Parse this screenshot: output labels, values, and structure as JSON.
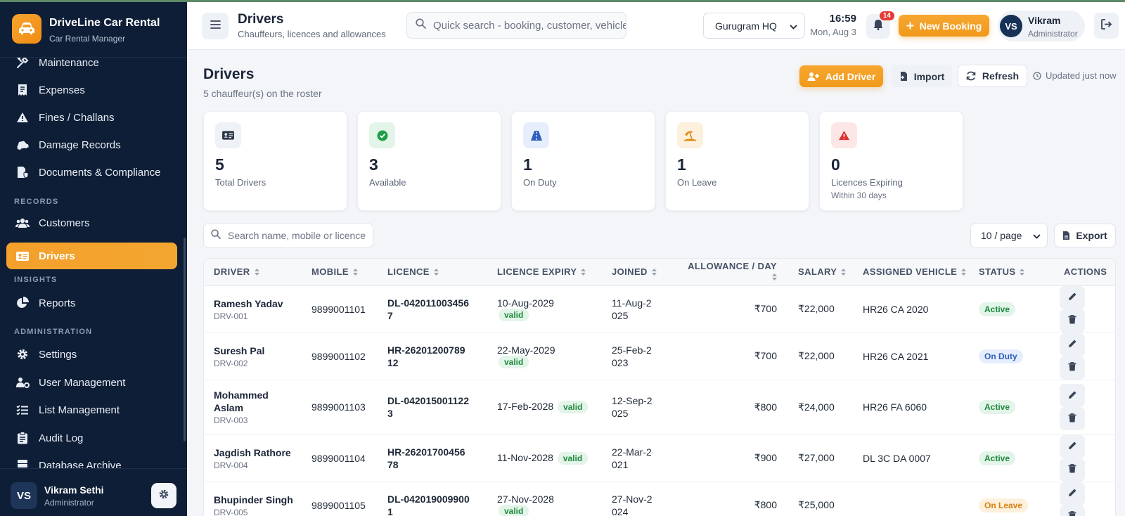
{
  "brand": {
    "name": "DriveLine Car Rental",
    "subtitle": "Car Rental Manager"
  },
  "sidebar": {
    "items": [
      {
        "label": "Maintenance",
        "icon": "tools-icon"
      },
      {
        "label": "Expenses",
        "icon": "receipt-icon"
      },
      {
        "label": "Fines / Challans",
        "icon": "warning-icon"
      },
      {
        "label": "Damage Records",
        "icon": "car-crash-icon"
      },
      {
        "label": "Documents & Compliance",
        "icon": "file-shield-icon"
      }
    ],
    "section_records": "RECORDS",
    "records_items": [
      {
        "label": "Customers",
        "icon": "users-icon"
      },
      {
        "label": "Drivers",
        "icon": "id-card-icon",
        "active": true
      }
    ],
    "section_insights": "INSIGHTS",
    "insights_items": [
      {
        "label": "Reports",
        "icon": "pie-chart-icon"
      }
    ],
    "section_admin": "ADMINISTRATION",
    "admin_items": [
      {
        "label": "Settings",
        "icon": "gear-icon"
      },
      {
        "label": "User Management",
        "icon": "user-gear-icon"
      },
      {
        "label": "List Management",
        "icon": "list-icon"
      },
      {
        "label": "Audit Log",
        "icon": "clipboard-icon"
      },
      {
        "label": "Database Archive",
        "icon": "database-icon"
      }
    ],
    "user": {
      "initials": "VS",
      "name": "Vikram Sethi",
      "role": "Administrator"
    }
  },
  "header": {
    "title": "Drivers",
    "subtitle": "Chauffeurs, licences and allowances",
    "search_placeholder": "Quick search - booking, customer, vehicle",
    "branch": "Gurugram HQ",
    "time": "16:59",
    "date": "Mon, Aug 3",
    "notifications": "14",
    "new_booking": "New Booking",
    "user": {
      "initials": "VS",
      "name": "Vikram",
      "role": "Administrator"
    }
  },
  "page": {
    "title": "Drivers",
    "subtitle": "5 chauffeur(s) on the roster",
    "add_driver": "Add Driver",
    "import": "Import",
    "refresh": "Refresh",
    "updated": "Updated just now"
  },
  "stats": [
    {
      "value": "5",
      "label": "Total Drivers",
      "icon": "id-card-icon",
      "color": "#2b3546",
      "bg": "#eef1f6"
    },
    {
      "value": "3",
      "label": "Available",
      "icon": "check-circle-icon",
      "color": "#1e9e48",
      "bg": "#e3f4e8"
    },
    {
      "value": "1",
      "label": "On Duty",
      "icon": "road-icon",
      "color": "#2f5fbf",
      "bg": "#e6eefc"
    },
    {
      "value": "1",
      "label": "On Leave",
      "icon": "umbrella-beach-icon",
      "color": "#e08a12",
      "bg": "#fdf0dc"
    },
    {
      "value": "0",
      "label": "Licences Expiring",
      "note": "Within 30 days",
      "icon": "alert-triangle-icon",
      "color": "#d93030",
      "bg": "#fde6e6"
    }
  ],
  "table": {
    "search_placeholder": "Search name, mobile or licence",
    "page_size": "10 / page",
    "export": "Export",
    "columns": [
      "DRIVER",
      "MOBILE",
      "LICENCE",
      "LICENCE EXPIRY",
      "JOINED",
      "ALLOWANCE / DAY",
      "SALARY",
      "ASSIGNED VEHICLE",
      "STATUS",
      "ACTIONS"
    ],
    "rows": [
      {
        "name": "Ramesh Yadav",
        "code": "DRV-001",
        "mobile": "9899001101",
        "licence": "DL-0420110034567",
        "expiry": "10-Aug-2029",
        "expiry_badge": "valid",
        "joined": "11-Aug-2025",
        "allowance": "₹700",
        "salary": "₹22,000",
        "vehicle": "HR26 CA 2020",
        "status": "Active"
      },
      {
        "name": "Suresh Pal",
        "code": "DRV-002",
        "mobile": "9899001102",
        "licence": "HR-2620120078912",
        "expiry": "22-May-2029",
        "expiry_badge": "valid",
        "joined": "25-Feb-2023",
        "allowance": "₹700",
        "salary": "₹22,000",
        "vehicle": "HR26 CA 2021",
        "status": "On Duty"
      },
      {
        "name": "Mohammed Aslam",
        "code": "DRV-003",
        "mobile": "9899001103",
        "licence": "DL-0420150011223",
        "expiry": "17-Feb-2028",
        "expiry_badge": "valid",
        "joined": "12-Sep-2025",
        "allowance": "₹800",
        "salary": "₹24,000",
        "vehicle": "HR26 FA 6060",
        "status": "Active"
      },
      {
        "name": "Jagdish Rathore",
        "code": "DRV-004",
        "mobile": "9899001104",
        "licence": "HR-2620170045678",
        "expiry": "11-Nov-2028",
        "expiry_badge": "valid",
        "joined": "22-Mar-2021",
        "allowance": "₹900",
        "salary": "₹27,000",
        "vehicle": "DL 3C DA 0007",
        "status": "Active"
      },
      {
        "name": "Bhupinder Singh",
        "code": "DRV-005",
        "mobile": "9899001105",
        "licence": "DL-0420190099001",
        "expiry": "27-Nov-2028",
        "expiry_badge": "valid",
        "joined": "27-Nov-2024",
        "allowance": "₹800",
        "salary": "₹25,000",
        "vehicle": "",
        "status": "On Leave"
      }
    ]
  },
  "colors": {
    "accent": "#f39c1f",
    "sidebar_bg": "#0e1e36",
    "active": "#1e8a3e",
    "on_duty": "#2f5fbf",
    "on_leave": "#d2820f"
  }
}
